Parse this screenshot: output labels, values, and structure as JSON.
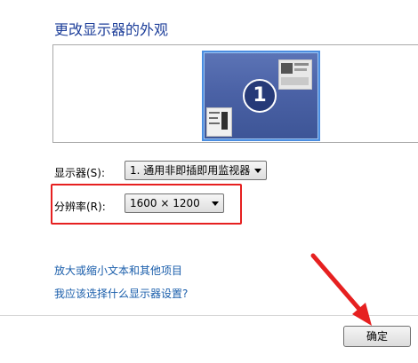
{
  "page": {
    "title": "更改显示器的外观"
  },
  "preview": {
    "monitor_number": "1"
  },
  "display": {
    "label": "显示器(S):",
    "selected": "1. 通用非即插即用监视器"
  },
  "resolution": {
    "label": "分辨率(R):",
    "selected": "1600 × 1200"
  },
  "links": {
    "text_size": "放大或缩小文本和其他项目",
    "which_settings": "我应该选择什么显示器设置?"
  },
  "buttons": {
    "ok": "确定"
  },
  "colors": {
    "accent": "#1e3f9a",
    "link": "#1a5eab",
    "annotation": "#e62020"
  }
}
